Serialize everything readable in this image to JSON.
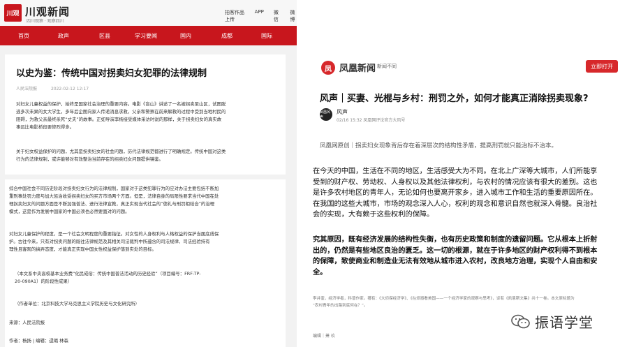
{
  "left": {
    "logo_mark": "川观",
    "logo_name": "川观新闻",
    "logo_tagline": "四川观察 · 观察四川",
    "toplinks": [
      "拍客作品上传",
      "APP",
      "微信",
      "微博"
    ],
    "nav": [
      "首页",
      "政声",
      "区县",
      "学习要闻",
      "国内",
      "成都",
      "国际"
    ],
    "article_title": "以史为鉴：传统中国对拐卖妇女犯罪的法律规制",
    "source": "人民法院报",
    "date": "2022-02-12 12:17",
    "para1": [
      "对妇女儿童权益的保护，始终是国家社会治理的重要内容。电影《盲山》讲述了一名被拐卖至山区，试图脱",
      "逃多次未果的女大学生，多年后企图向家人传递消息求救，父亲和警察在前来解救的过程中受到当地村民的",
      "阻碍，为救父亲最终杀死“丈夫”的故事。正如导演李杨接受媒体采访时说的那样，关于拐卖妇女的真实故",
      "事远比电影桥段要惨烈得多。"
    ],
    "para2": [
      "关于妇女权益保护的问题，尤其是拐卖妇女的社会问题，历代法律规范都进行了明确规定。传统中国对这类",
      "行为的法律规制，或许能够对有效整治当前存在的拐卖妇女问题提供镜鉴。"
    ],
    "para3": [
      "综合中国社会不同历史阶段对拐卖妇女行为的法律规制，国家对于这类犯罪行为的应对办法主要包括不断加",
      "重刑事处罚力度与加大惩治收受拐卖妇女的买方市场两个方面。但是，法律自身的局限性要求当代中国在处",
      "理拐卖妇女的问题方面是不断加强普法、进行法律宣教，真正实现当代社会的“德礼与刑罚相结合”的治理",
      "模式，这是作为发展中国家的中国必须也必然要面对的问题。"
    ],
    "para4": [
      "对妇女儿童保护的程度，是一个社会文明程度的重要指征。对女性的人身权利与人格权益的保护当属底线保",
      "护。古往今来，只有对拐卖问题的既往法律规范及其相关司法裁判中所蕴含的司法规律、司法经验持有",
      "理性且客观的搞弄态度，才能真正实现中国女性权益保护落到实处的目标。"
    ],
    "funding": [
      "（本文系中央高校基本业务费“化民成俗：传统中国普法活动的历史经验”（项目编号：FRF-TP-",
      "20-090A1）的阶段性成果）"
    ],
    "author": "（作者单位：北京科技大学马克思主义学院历史与文化研究所）",
    "source_line": "来源：人民法院报",
    "editor_line": "作者：杨扬 | 编辑：逯璐 林森"
  },
  "right": {
    "logo_mark": "凤",
    "logo_name": "凤凰新闻",
    "logo_slogan": "新闻不同",
    "open_button": "立即打开",
    "title": "风声｜买妻、光棍与乡村：刑罚之外，如何才能真正消除拐卖现象?",
    "avatar_label": "凤凰风声",
    "author": "风声",
    "date": "02/16 15:32  凤凰网评论官方大风号",
    "summary": "凤凰网原创｜拐卖妇女现象背后存在着深层次的结构性矛盾，提高刑罚就只能治标不治本。",
    "body1": [
      "在今天的中国，生活在不同的地区，生活感受大为不同。在北上广深等大城市，人们所能享",
      "受到的财产权、劳动权、人身权以及其他法律权利，与农村的情况应该有很大的差别。这也",
      "是许多农村地区的青年人，无论如何也要离开家乡，进入城市工作和生活的重要原因所在。",
      "在我国的这些大城市，市场的观念深入人心，权利的观念和意识自然也就深入骨髓。良治社",
      "会的实现，大有赖于这些权利的保障。"
    ],
    "body2": [
      "究其原因，既有经济发展的结构性失衡，也有历史政策和制度的遗留问题。它从根本上折射",
      "出的，仍然是有些地区良治的匮乏。这一切的根源，就在于许多地区的财产权利得不到根本",
      "的保障，致使商业和制造业无法有效地从城市进入农村，改良地方治理，实现个人自由和安",
      "全。"
    ],
    "author_note": [
      "李井奎，经济学者，科普作家。著有：《大侦探经济学》、《在烦嚣看美国——一个经济学家的观察与思考》，译有《凯恩斯文集》共十一卷。本文原标题为",
      "“农村青年的出路到底何在？”。"
    ],
    "editor": "编辑｜萧 玖"
  },
  "watermark": "振语学堂",
  "colors": {
    "chuanguan_red": "#c8161d",
    "ifeng_red": "#d7282b"
  }
}
